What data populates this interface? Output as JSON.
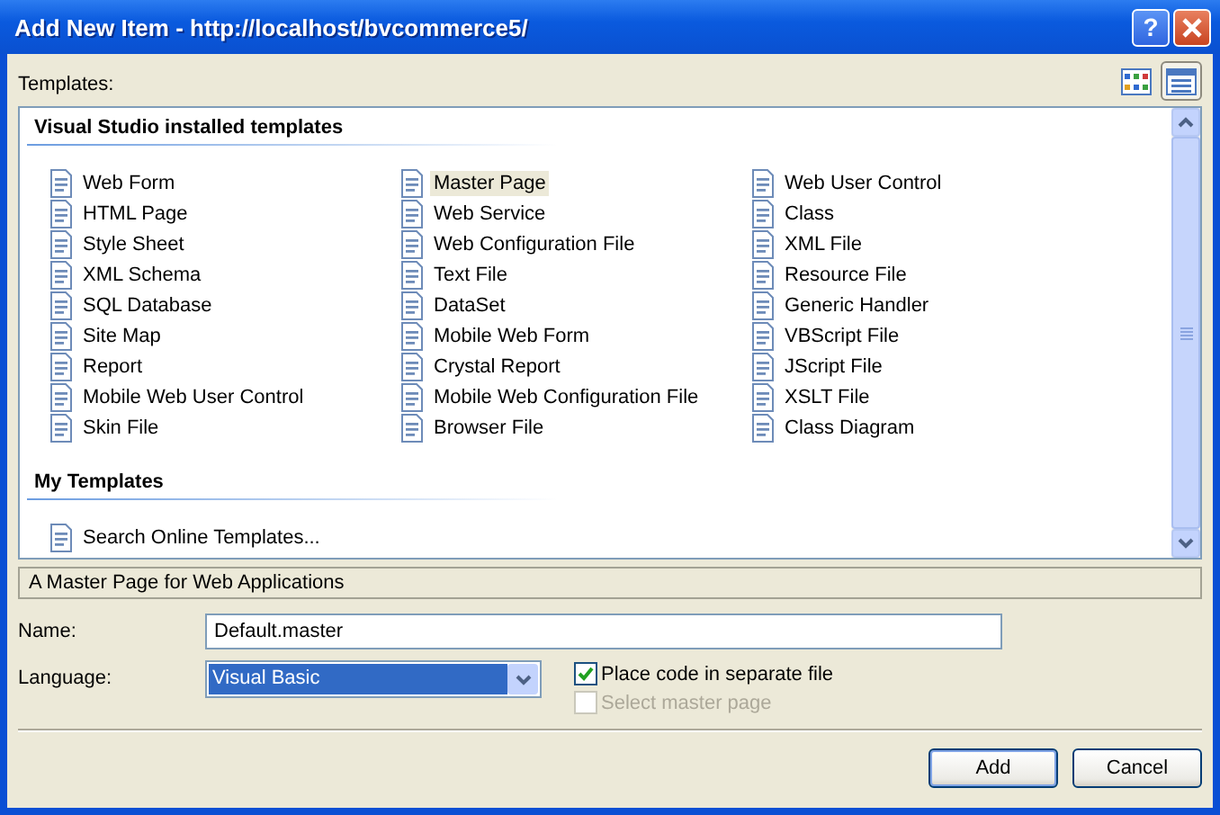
{
  "window": {
    "title": "Add New Item - http://localhost/bvcommerce5/",
    "help_label": "?"
  },
  "templates_label": "Templates:",
  "view_buttons": [
    {
      "kind": "large-icons",
      "selected": false
    },
    {
      "kind": "small-icons",
      "selected": true
    }
  ],
  "sections": [
    {
      "title": "Visual Studio installed templates",
      "items": [
        {
          "label": "Web Form",
          "selected": false
        },
        {
          "label": "HTML Page",
          "selected": false
        },
        {
          "label": "Style Sheet",
          "selected": false
        },
        {
          "label": "XML Schema",
          "selected": false
        },
        {
          "label": "SQL Database",
          "selected": false
        },
        {
          "label": "Site Map",
          "selected": false
        },
        {
          "label": "Report",
          "selected": false
        },
        {
          "label": "Mobile Web User Control",
          "selected": false
        },
        {
          "label": "Skin File",
          "selected": false
        },
        {
          "label": "Master Page",
          "selected": true
        },
        {
          "label": "Web Service",
          "selected": false
        },
        {
          "label": "Web Configuration File",
          "selected": false
        },
        {
          "label": "Text File",
          "selected": false
        },
        {
          "label": "DataSet",
          "selected": false
        },
        {
          "label": "Mobile Web Form",
          "selected": false
        },
        {
          "label": "Crystal Report",
          "selected": false
        },
        {
          "label": "Mobile Web Configuration File",
          "selected": false
        },
        {
          "label": "Browser File",
          "selected": false
        },
        {
          "label": "Web User Control",
          "selected": false
        },
        {
          "label": "Class",
          "selected": false
        },
        {
          "label": "XML File",
          "selected": false
        },
        {
          "label": "Resource File",
          "selected": false
        },
        {
          "label": "Generic Handler",
          "selected": false
        },
        {
          "label": "VBScript File",
          "selected": false
        },
        {
          "label": "JScript File",
          "selected": false
        },
        {
          "label": "XSLT File",
          "selected": false
        },
        {
          "label": "Class Diagram",
          "selected": false
        }
      ]
    },
    {
      "title": "My Templates",
      "items": [
        {
          "label": "Search Online Templates...",
          "selected": false
        }
      ]
    }
  ],
  "description": "A Master Page for Web Applications",
  "name_field": {
    "label": "Name:",
    "value": "Default.master"
  },
  "language_field": {
    "label": "Language:",
    "value": "Visual Basic"
  },
  "options": [
    {
      "label": "Place code in separate file",
      "checked": true,
      "disabled": false
    },
    {
      "label": "Select master page",
      "checked": false,
      "disabled": true
    }
  ],
  "buttons": [
    {
      "label": "Add",
      "kind": "default"
    },
    {
      "label": "Cancel",
      "kind": "normal"
    }
  ]
}
